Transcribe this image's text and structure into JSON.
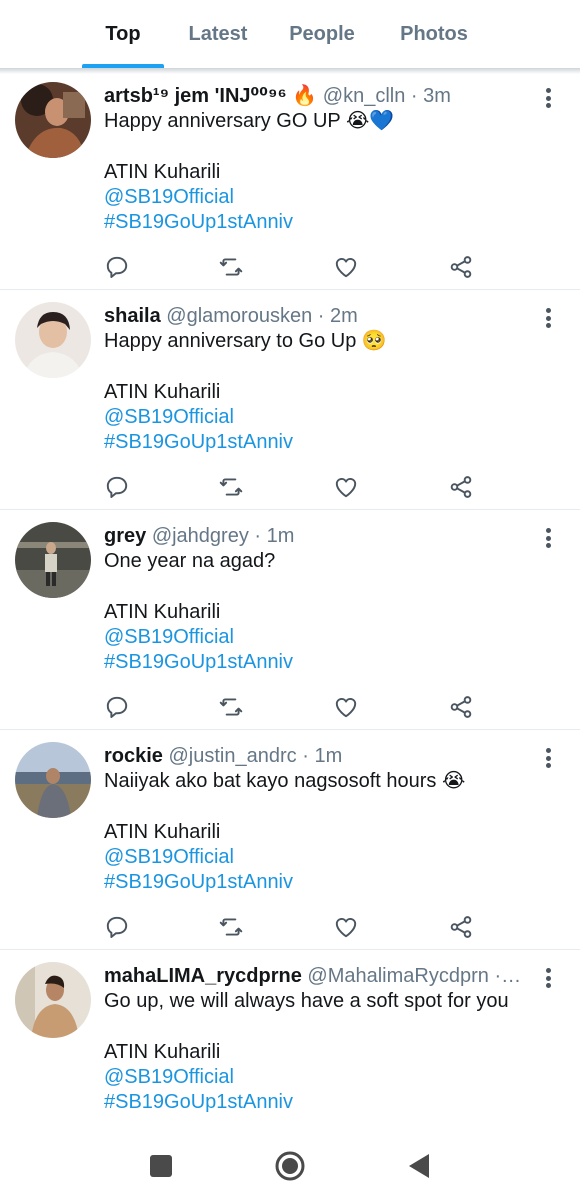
{
  "tabs": [
    {
      "label": "Top",
      "active": true
    },
    {
      "label": "Latest",
      "active": false
    },
    {
      "label": "People",
      "active": false
    },
    {
      "label": "Photos",
      "active": false
    }
  ],
  "tweets": [
    {
      "name": "artsb¹⁹ jem 'INJ⁰⁰⁹⁶ 🔥",
      "handle": "@kn_clln",
      "dot": "·",
      "time": "3m",
      "text": "Happy anniversary GO UP 😭💙",
      "line2": "ATIN Kuharili",
      "mention": "@SB19Official",
      "hashtag": "#SB19GoUp1stAnniv",
      "avatar_color": "#6b4a3a"
    },
    {
      "name": "shaila",
      "handle": "@glamorousken",
      "dot": "·",
      "time": "2m",
      "text": "Happy anniversary to Go Up 🥺",
      "line2": "ATIN Kuharili",
      "mention": "@SB19Official",
      "hashtag": "#SB19GoUp1stAnniv",
      "avatar_color": "#e8e2dc"
    },
    {
      "name": "grey",
      "handle": "@jahdgrey",
      "dot": "·",
      "time": "1m",
      "text": "One year na agad?",
      "line2": "ATIN Kuharili",
      "mention": "@SB19Official",
      "hashtag": "#SB19GoUp1stAnniv",
      "avatar_color": "#3a3a36"
    },
    {
      "name": "rockie",
      "handle": "@justin_andrc",
      "dot": "·",
      "time": "1m",
      "text": "Naiiyak ako bat kayo nagsosoft hours 😭",
      "line2": "ATIN Kuharili",
      "mention": "@SB19Official",
      "hashtag": "#SB19GoUp1stAnniv",
      "avatar_color": "#7c8a9c"
    },
    {
      "name": "mahaLIMA_rycdprne",
      "handle": "@MahalimaRycdprn",
      "dot": "·…",
      "time": "",
      "text": "Go up, we will always have a soft spot for you",
      "line2": "ATIN Kuharili",
      "mention": "@SB19Official",
      "hashtag": "#SB19GoUp1stAnniv",
      "avatar_color": "#c9a98a"
    }
  ],
  "icons": {
    "reply": "reply-icon",
    "retweet": "retweet-icon",
    "like": "heart-icon",
    "share": "share-icon",
    "menu": "more-vertical-icon"
  },
  "colors": {
    "accent": "#1da1f2",
    "link": "#1b95e0",
    "secondary_text": "#657786"
  },
  "navbar": [
    "recent-apps-icon",
    "home-icon",
    "back-icon"
  ]
}
